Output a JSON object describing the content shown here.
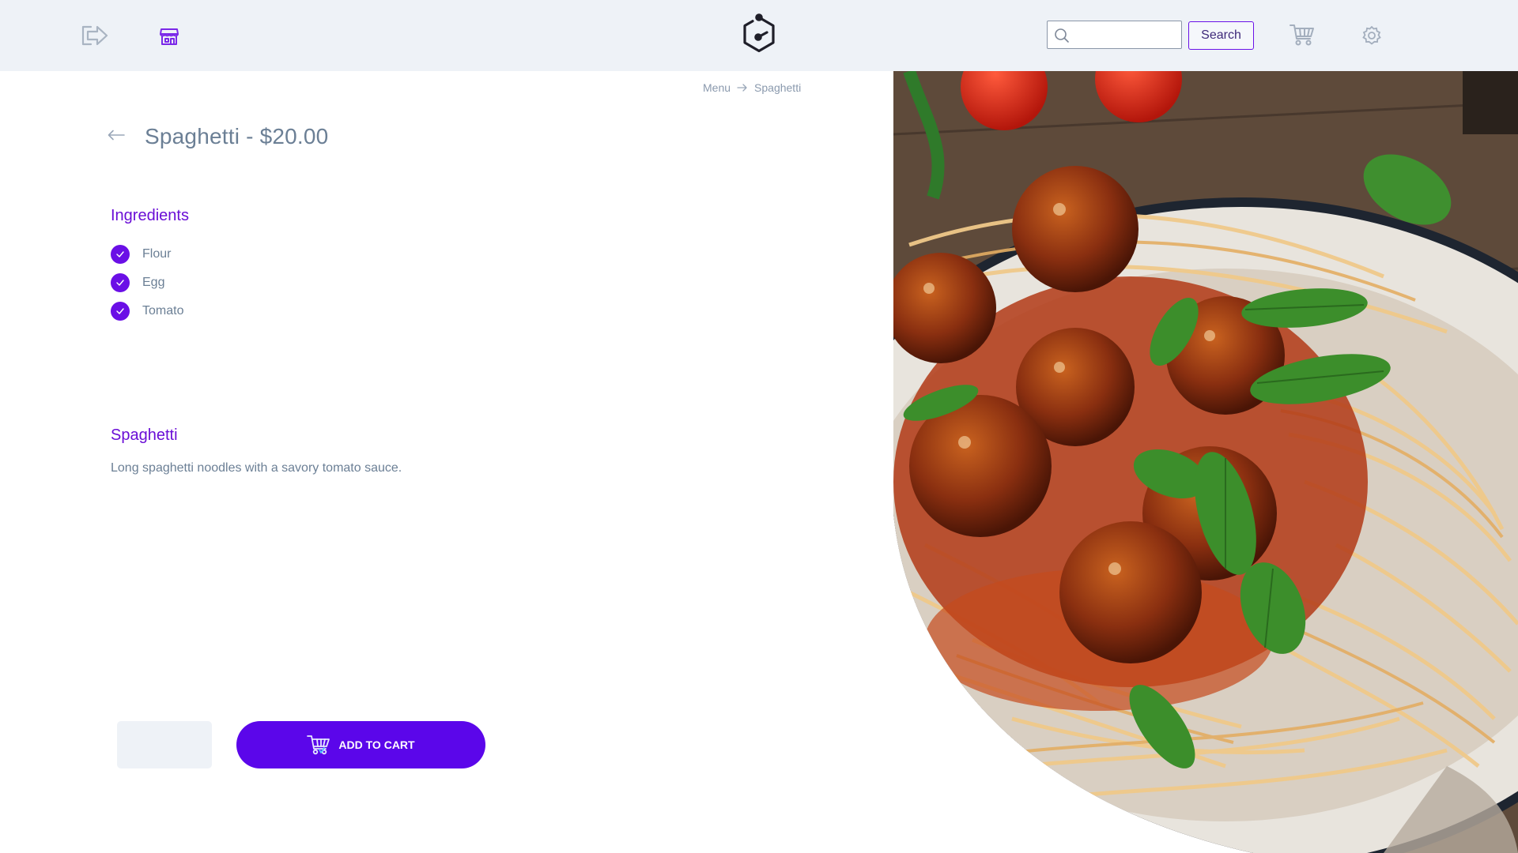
{
  "header": {
    "logout_icon": "logout-icon",
    "store_icon": "store-icon",
    "logo_icon": "hexagon-logo-icon",
    "search": {
      "placeholder": "",
      "value": "",
      "button_label": "Search"
    },
    "cart_icon": "cart-icon",
    "settings_icon": "gear-icon"
  },
  "breadcrumb": {
    "items": [
      "Menu",
      "Spaghetti"
    ]
  },
  "product": {
    "title": "Spaghetti - $20.00",
    "ingredients_heading": "Ingredients",
    "ingredients": [
      "Flour",
      "Egg",
      "Tomato"
    ],
    "name_heading": "Spaghetti",
    "description": "Long spaghetti noodles with a savory tomato sauce.",
    "quantity": "",
    "add_to_cart_label": "ADD TO CART"
  },
  "colors": {
    "accent": "#5b06ea",
    "heading": "#6a0dd6",
    "text": "#6b7f95",
    "topbar": "#eef2f7"
  }
}
